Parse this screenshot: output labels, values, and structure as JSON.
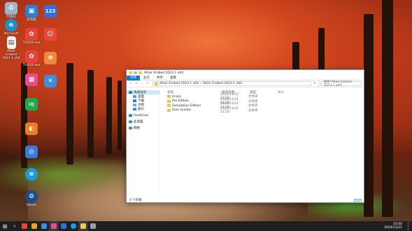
{
  "desktop": {
    "icons": [
      {
        "label": "回收站",
        "icon": "recycle-bin-icon",
        "color": "#9fb4c8"
      },
      {
        "label": "Microsoft\nEdge",
        "icon": "edge-icon",
        "color": "#1b8fd4"
      },
      {
        "label": "Altair\nEmbed\n2023.1 x64",
        "icon": "file-icon",
        "color": "#f3f3f3"
      },
      {
        "label": "此电脑",
        "icon": "computer-icon",
        "color": "#2b7fd8"
      },
      {
        "label": "TUXXX.exe",
        "icon": "app-icon",
        "color": "#e8413a"
      },
      {
        "label": "123",
        "icon": "app-icon",
        "color": "#2f6fe0"
      },
      {
        "label": "TUXXX.exe",
        "icon": "app-icon",
        "color": "#e8413a"
      },
      {
        "label": "",
        "icon": "app-icon",
        "color": "#e8473a"
      },
      {
        "label": "",
        "icon": "app-icon",
        "color": "#f08a3a"
      },
      {
        "label": "",
        "icon": "app-icon",
        "color": "#3a8de0"
      },
      {
        "label": "",
        "icon": "app-icon",
        "color": "#e94c8a"
      },
      {
        "label": "",
        "icon": "app-icon",
        "color": "#2f68d8"
      },
      {
        "label": "",
        "icon": "iqiyi-icon",
        "color": "#25a848"
      },
      {
        "label": "",
        "icon": "app-icon",
        "color": "#f07a22"
      },
      {
        "label": "",
        "icon": "app-icon",
        "color": "#3a7bd5"
      },
      {
        "label": "",
        "icon": "ie-icon",
        "color": "#1a9ae0"
      },
      {
        "label": "Steam",
        "icon": "steam-icon",
        "color": "#1b4d8a"
      }
    ]
  },
  "window": {
    "title": "Altair Embed 2023.1 x64",
    "ribbon_tabs": [
      "文件",
      "主页",
      "共享",
      "查看"
    ],
    "address": {
      "crumbs": [
        "Altair Embed 2023.1 x64",
        "Altair Embed 2023.1 x64"
      ],
      "search_placeholder": "搜索\"Altair Embed 2023.1 x64\""
    },
    "nav_items": [
      {
        "label": "快速访问",
        "icon": "star-icon",
        "color": "#2a79d6",
        "sub": false
      },
      {
        "label": "桌面",
        "icon": "desktop-icon",
        "color": "#4a9be5",
        "sub": true
      },
      {
        "label": "下载",
        "icon": "download-icon",
        "color": "#2a7bd6",
        "sub": true
      },
      {
        "label": "文档",
        "icon": "document-icon",
        "color": "#7f9fbf",
        "sub": true
      },
      {
        "label": "图片",
        "icon": "picture-icon",
        "color": "#3a8cd8",
        "sub": true
      },
      {
        "label": "OneDrive",
        "icon": "cloud-icon",
        "color": "#2a7bd6",
        "sub": false
      },
      {
        "label": "此电脑",
        "icon": "computer-icon",
        "color": "#3a88d8",
        "sub": false
      },
      {
        "label": "网络",
        "icon": "network-icon",
        "color": "#4a8bd0",
        "sub": false
      }
    ],
    "columns": {
      "name": "名称",
      "date": "修改日期",
      "type": "类型",
      "size": "大小"
    },
    "files": [
      {
        "name": "Crack",
        "date": "2024/11/21 21:59",
        "type": "文件夹"
      },
      {
        "name": "Pro Edition",
        "date": "2024/11/21 21:59",
        "type": "文件夹"
      },
      {
        "name": "Simulation Edition",
        "date": "2024/11/21 21:59",
        "type": "文件夹"
      },
      {
        "name": "User Guides",
        "date": "2024/11/21 21:59",
        "type": "文件夹"
      }
    ],
    "status": "4 个项目"
  },
  "taskbar": {
    "apps": [
      {
        "icon": "start-icon",
        "color": "#ffffff"
      },
      {
        "icon": "search-icon",
        "color": "#d0d0d0"
      },
      {
        "icon": "app-icon",
        "color": "#e8473a"
      },
      {
        "icon": "app-icon",
        "color": "#f0a12a"
      },
      {
        "icon": "app-icon",
        "color": "#3a8de0"
      },
      {
        "icon": "app-icon",
        "color": "#e94c8a"
      },
      {
        "icon": "app-icon",
        "color": "#2f6fe0"
      },
      {
        "icon": "app-icon",
        "color": "#1a9ae0"
      },
      {
        "icon": "file-explorer-icon",
        "color": "#f2c94c"
      },
      {
        "icon": "app-icon",
        "color": "#9aa0a6"
      }
    ],
    "time": "14:00",
    "date": "2024/11/21"
  }
}
